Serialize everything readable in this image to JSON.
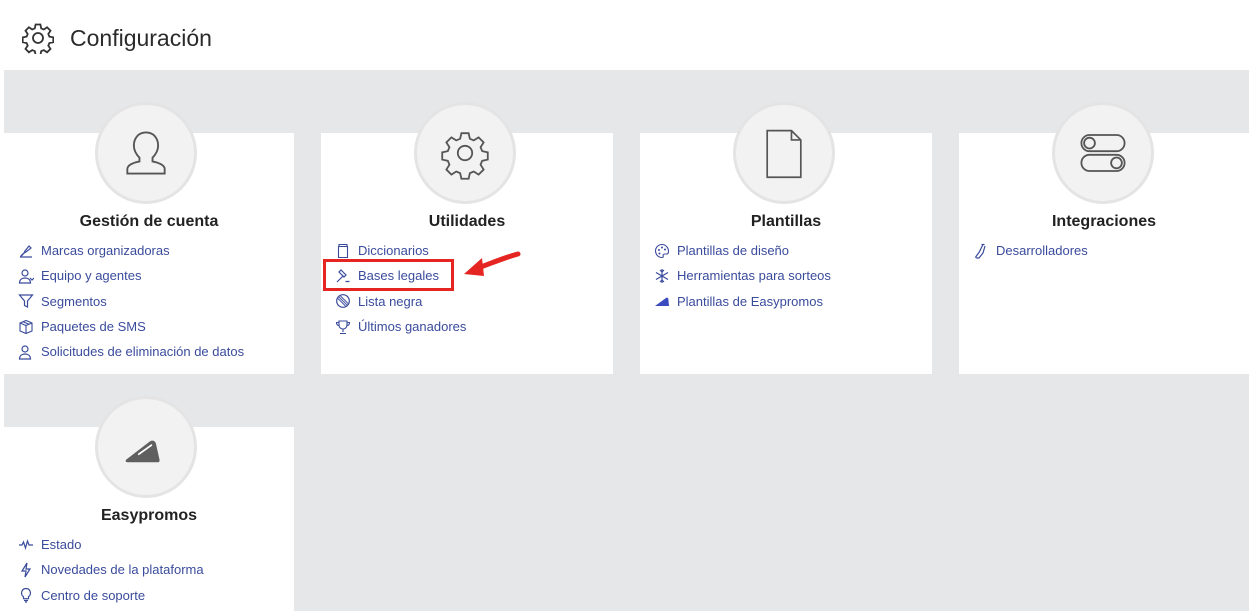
{
  "page": {
    "title": "Configuración",
    "title_icon": "gear-icon"
  },
  "cards": [
    {
      "title": "Gestión de cuenta",
      "icon": "user-icon",
      "items": [
        {
          "label": "Marcas organizadoras",
          "icon": "brand-icon"
        },
        {
          "label": "Equipo y agentes",
          "icon": "team-icon"
        },
        {
          "label": "Segmentos",
          "icon": "filter-icon"
        },
        {
          "label": "Paquetes de SMS",
          "icon": "package-icon"
        },
        {
          "label": "Solicitudes de eliminación de datos",
          "icon": "user-delete-icon"
        }
      ]
    },
    {
      "title": "Utilidades",
      "icon": "gear-icon",
      "items": [
        {
          "label": "Diccionarios",
          "icon": "jar-icon"
        },
        {
          "label": "Bases legales",
          "icon": "gavel-icon"
        },
        {
          "label": "Lista negra",
          "icon": "blocked-icon"
        },
        {
          "label": "Últimos ganadores",
          "icon": "trophy-icon"
        }
      ]
    },
    {
      "title": "Plantillas",
      "icon": "document-icon",
      "items": [
        {
          "label": "Plantillas de diseño",
          "icon": "palette-icon"
        },
        {
          "label": "Herramientas para sorteos",
          "icon": "snowflake-icon"
        },
        {
          "label": "Plantillas de Easypromos",
          "icon": "easypromos-logo-icon"
        }
      ]
    },
    {
      "title": "Integraciones",
      "icon": "toggle-icon",
      "items": [
        {
          "label": "Desarrolladores",
          "icon": "flask-icon"
        }
      ]
    },
    {
      "title": "Easypromos",
      "icon": "easypromos-logo-icon",
      "items": [
        {
          "label": "Estado",
          "icon": "pulse-icon"
        },
        {
          "label": "Novedades de la plataforma",
          "icon": "bolt-icon"
        },
        {
          "label": "Centro de soporte",
          "icon": "lightbulb-icon"
        }
      ]
    }
  ],
  "annotation": {
    "highlight_color": "#e52521",
    "highlighted_item": "Bases legales"
  },
  "colors": {
    "link": "#3a4b9c",
    "background": "#e6e7e9",
    "card": "#ffffff"
  }
}
